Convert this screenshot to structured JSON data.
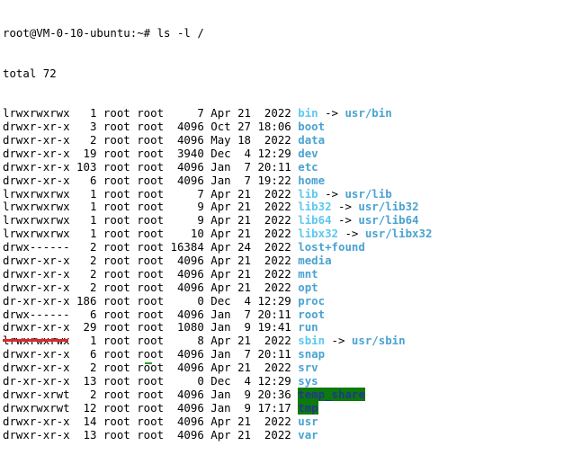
{
  "terminal": {
    "prompt": "root@VM-0-10-ubuntu:~# ls -l /",
    "total": "total 72",
    "entries": [
      {
        "perm": "lrwxrwxrwx",
        "links": "1",
        "owner": "root",
        "group": "root",
        "size": "7",
        "date": "Apr 21  2022",
        "name": "bin",
        "kind": "link",
        "target": "usr/bin"
      },
      {
        "perm": "drwxr-xr-x",
        "links": "3",
        "owner": "root",
        "group": "root",
        "size": "4096",
        "date": "Oct 27 18:06",
        "name": "boot",
        "kind": "dir"
      },
      {
        "perm": "drwxr-xr-x",
        "links": "2",
        "owner": "root",
        "group": "root",
        "size": "4096",
        "date": "May 18  2022",
        "name": "data",
        "kind": "dir"
      },
      {
        "perm": "drwxr-xr-x",
        "links": "19",
        "owner": "root",
        "group": "root",
        "size": "3940",
        "date": "Dec  4 12:29",
        "name": "dev",
        "kind": "dir"
      },
      {
        "perm": "drwxr-xr-x",
        "links": "103",
        "owner": "root",
        "group": "root",
        "size": "4096",
        "date": "Jan  7 20:11",
        "name": "etc",
        "kind": "dir"
      },
      {
        "perm": "drwxr-xr-x",
        "links": "6",
        "owner": "root",
        "group": "root",
        "size": "4096",
        "date": "Jan  7 19:22",
        "name": "home",
        "kind": "dir"
      },
      {
        "perm": "lrwxrwxrwx",
        "links": "1",
        "owner": "root",
        "group": "root",
        "size": "7",
        "date": "Apr 21  2022",
        "name": "lib",
        "kind": "link",
        "target": "usr/lib"
      },
      {
        "perm": "lrwxrwxrwx",
        "links": "1",
        "owner": "root",
        "group": "root",
        "size": "9",
        "date": "Apr 21  2022",
        "name": "lib32",
        "kind": "link",
        "target": "usr/lib32"
      },
      {
        "perm": "lrwxrwxrwx",
        "links": "1",
        "owner": "root",
        "group": "root",
        "size": "9",
        "date": "Apr 21  2022",
        "name": "lib64",
        "kind": "link",
        "target": "usr/lib64"
      },
      {
        "perm": "lrwxrwxrwx",
        "links": "1",
        "owner": "root",
        "group": "root",
        "size": "10",
        "date": "Apr 21  2022",
        "name": "libx32",
        "kind": "link",
        "target": "usr/libx32"
      },
      {
        "perm": "drwx------",
        "links": "2",
        "owner": "root",
        "group": "root",
        "size": "16384",
        "date": "Apr 24  2022",
        "name": "lost+found",
        "kind": "dir"
      },
      {
        "perm": "drwxr-xr-x",
        "links": "2",
        "owner": "root",
        "group": "root",
        "size": "4096",
        "date": "Apr 21  2022",
        "name": "media",
        "kind": "dir"
      },
      {
        "perm": "drwxr-xr-x",
        "links": "2",
        "owner": "root",
        "group": "root",
        "size": "4096",
        "date": "Apr 21  2022",
        "name": "mnt",
        "kind": "dir"
      },
      {
        "perm": "drwxr-xr-x",
        "links": "2",
        "owner": "root",
        "group": "root",
        "size": "4096",
        "date": "Apr 21  2022",
        "name": "opt",
        "kind": "dir"
      },
      {
        "perm": "dr-xr-xr-x",
        "links": "186",
        "owner": "root",
        "group": "root",
        "size": "0",
        "date": "Dec  4 12:29",
        "name": "proc",
        "kind": "dir"
      },
      {
        "perm": "drwx------",
        "links": "6",
        "owner": "root",
        "group": "root",
        "size": "4096",
        "date": "Jan  7 20:11",
        "name": "root",
        "kind": "dir"
      },
      {
        "perm": "drwxr-xr-x",
        "links": "29",
        "owner": "root",
        "group": "root",
        "size": "1080",
        "date": "Jan  9 19:41",
        "name": "run",
        "kind": "dir"
      },
      {
        "perm": "lrwxrwxrwx",
        "links": "1",
        "owner": "root",
        "group": "root",
        "size": "8",
        "date": "Apr 21  2022",
        "name": "sbin",
        "kind": "link",
        "target": "usr/sbin"
      },
      {
        "perm": "drwxr-xr-x",
        "links": "6",
        "owner": "root",
        "group": "root",
        "size": "4096",
        "date": "Jan  7 20:11",
        "name": "snap",
        "kind": "dir"
      },
      {
        "perm": "drwxr-xr-x",
        "links": "2",
        "owner": "root",
        "group": "root",
        "size": "4096",
        "date": "Apr 21  2022",
        "name": "srv",
        "kind": "dir"
      },
      {
        "perm": "dr-xr-xr-x",
        "links": "13",
        "owner": "root",
        "group": "root",
        "size": "0",
        "date": "Dec  4 12:29",
        "name": "sys",
        "kind": "dir"
      },
      {
        "perm": "drwxr-xrwt",
        "links": "2",
        "owner": "root",
        "group": "root",
        "size": "4096",
        "date": "Jan  9 20:36",
        "name": "temp_share",
        "kind": "sticky"
      },
      {
        "perm": "drwxrwxrwt",
        "links": "12",
        "owner": "root",
        "group": "root",
        "size": "4096",
        "date": "Jan  9 17:17",
        "name": "tmp",
        "kind": "sticky"
      },
      {
        "perm": "drwxr-xr-x",
        "links": "14",
        "owner": "root",
        "group": "root",
        "size": "4096",
        "date": "Apr 21  2022",
        "name": "usr",
        "kind": "dir"
      },
      {
        "perm": "drwxr-xr-x",
        "links": "13",
        "owner": "root",
        "group": "root",
        "size": "4096",
        "date": "Apr 21  2022",
        "name": "var",
        "kind": "dir"
      }
    ],
    "arrow": " -> ",
    "colors": {
      "dir": "#4aa3d1",
      "link": "#5cc8f0",
      "sticky_bg": "#0c7a0c",
      "underline": "#e0262b"
    }
  }
}
